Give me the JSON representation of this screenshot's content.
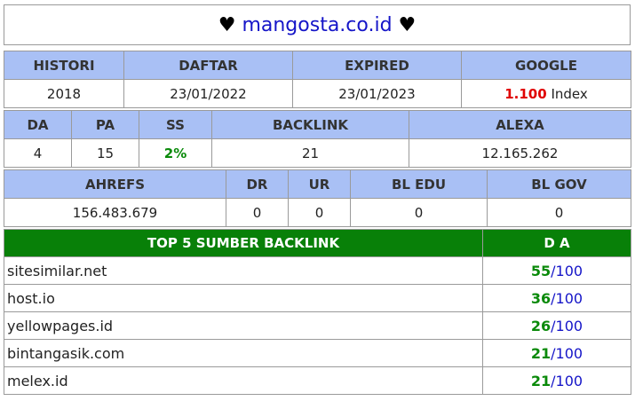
{
  "header": {
    "heart_left": "♥",
    "site": "mangosta.co.id",
    "heart_right": "♥"
  },
  "info": {
    "headers": [
      "HISTORI",
      "DAFTAR",
      "EXPIRED",
      "GOOGLE"
    ],
    "histori": "2018",
    "daftar": "23/01/2022",
    "expired": "23/01/2023",
    "google_value": "1.100",
    "google_suffix": " Index"
  },
  "metrics": {
    "headers": [
      "DA",
      "PA",
      "SS",
      "BACKLINK",
      "ALEXA"
    ],
    "da": "4",
    "pa": "15",
    "ss": "2%",
    "backlink": "21",
    "alexa": "12.165.262"
  },
  "ahrefs": {
    "headers": [
      "AHREFS",
      "DR",
      "UR",
      "BL EDU",
      "BL GOV"
    ],
    "ahrefs": "156.483.679",
    "dr": "0",
    "ur": "0",
    "bl_edu": "0",
    "bl_gov": "0"
  },
  "backlinks": {
    "header_source": "TOP 5 SUMBER BACKLINK",
    "header_da": "D A",
    "rows": [
      {
        "source": "sitesimilar.net",
        "da": "55",
        "max": "/100"
      },
      {
        "source": "host.io",
        "da": "36",
        "max": "/100"
      },
      {
        "source": "yellowpages.id",
        "da": "26",
        "max": "/100"
      },
      {
        "source": "bintangasik.com",
        "da": "21",
        "max": "/100"
      },
      {
        "source": "melex.id",
        "da": "21",
        "max": "/100"
      }
    ]
  },
  "colors": {
    "header_bg": "#a9c0f5",
    "backlink_header_bg": "#088008",
    "accent_red": "#e00000",
    "accent_green": "#0a8a0a",
    "accent_blue": "#1515c8"
  }
}
